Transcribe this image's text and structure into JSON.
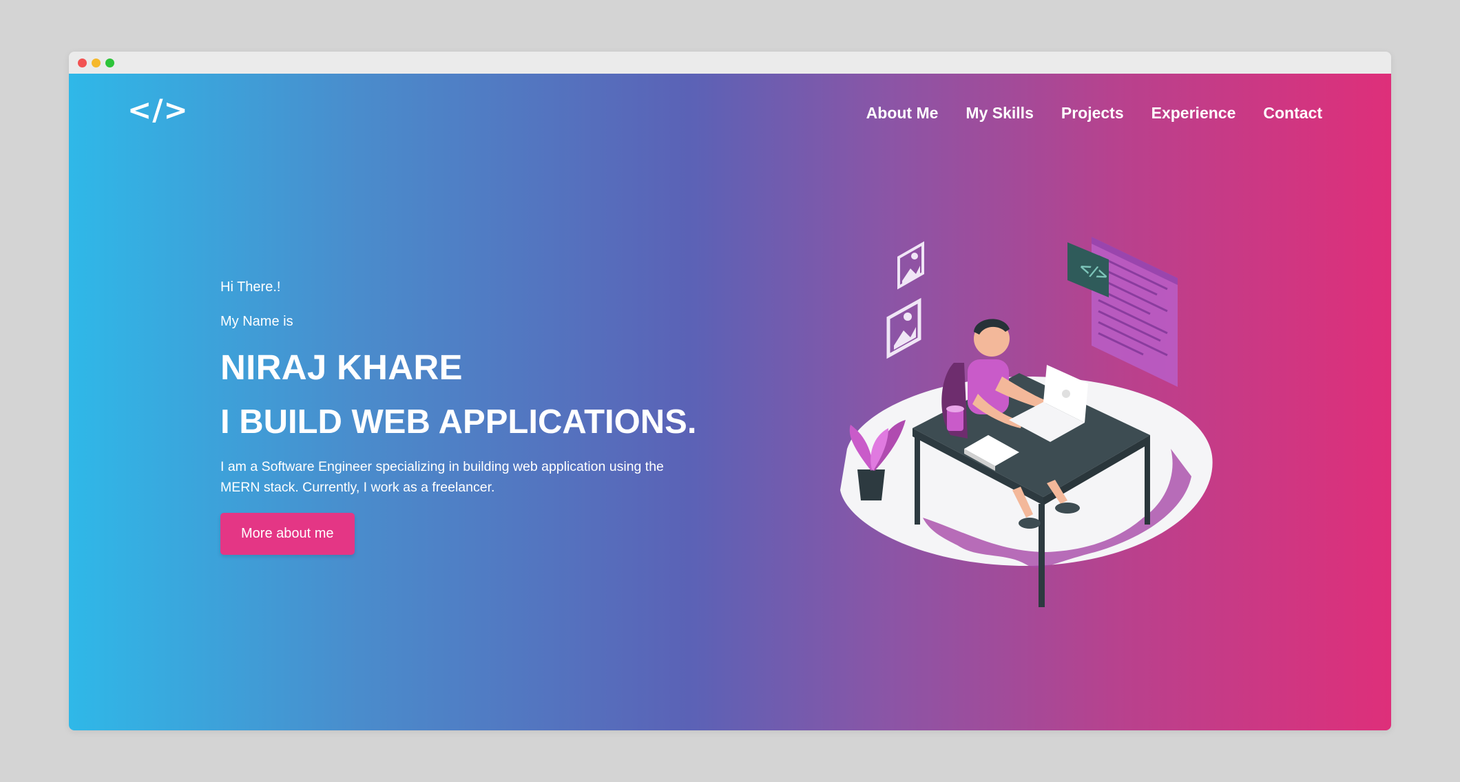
{
  "browser": {
    "controls": [
      "close",
      "minimize",
      "maximize"
    ]
  },
  "header": {
    "logo_text": "</>",
    "nav": [
      {
        "label": "About Me"
      },
      {
        "label": "My Skills"
      },
      {
        "label": "Projects"
      },
      {
        "label": "Experience"
      },
      {
        "label": "Contact"
      }
    ]
  },
  "hero": {
    "greeting": "Hi There.!",
    "name_intro": "My Name is",
    "name": "NIRAJ KHARE",
    "tagline": "I BUILD WEB APPLICATIONS.",
    "description": "I am a Software Engineer specializing in building web application using the MERN stack. Currently, I work as a freelancer.",
    "cta_label": "More about me"
  },
  "illustration": {
    "icon": "developer-at-desk-illustration"
  },
  "colors": {
    "gradient_start": "#2fb8e8",
    "gradient_mid": "#5b62b6",
    "gradient_end": "#de2f7a",
    "button": "#e43685",
    "text": "#ffffff"
  }
}
